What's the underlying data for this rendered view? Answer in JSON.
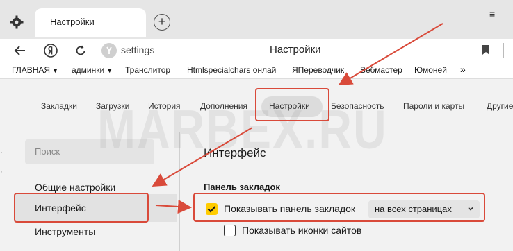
{
  "browser": {
    "tab": {
      "title": "Настройки"
    },
    "new_tab_label": "+",
    "menu_label": "≡",
    "address": {
      "url": "settings",
      "page_title": "Настройки"
    },
    "bookmarks": [
      {
        "label": "ГЛАВНАЯ",
        "has_menu": true
      },
      {
        "label": "админки",
        "has_menu": true
      },
      {
        "label": "Транслитор"
      },
      {
        "label": "Htmlspecialchars онлай"
      },
      {
        "label": "ЯПереводчик"
      },
      {
        "label": "Вебмастер"
      },
      {
        "label": "Юмоней"
      }
    ],
    "bookmarks_overflow": "»"
  },
  "settings": {
    "top_nav": [
      {
        "label": "Закладки"
      },
      {
        "label": "Загрузки"
      },
      {
        "label": "История"
      },
      {
        "label": "Дополнения"
      },
      {
        "label": "Настройки",
        "active": true
      },
      {
        "label": "Безопасность"
      },
      {
        "label": "Пароли и карты"
      },
      {
        "label": "Другие"
      }
    ],
    "search_placeholder": "Поиск",
    "sidebar": [
      {
        "label": "Общие настройки"
      },
      {
        "label": "Интерфейс",
        "active": true
      },
      {
        "label": "Инструменты"
      }
    ],
    "section_title": "Интерфейс",
    "group_title": "Панель закладок",
    "options": [
      {
        "label": "Показывать панель закладок",
        "checked": true
      },
      {
        "label": "Показывать иконки сайтов",
        "checked": false
      }
    ],
    "dropdown_value": "на всех страницах"
  },
  "watermark": "MARBEX.RU",
  "colors": {
    "annotation": "#d94a3a",
    "checkbox_on": "#ffcc00",
    "active_bg": "#dcdcdc"
  }
}
